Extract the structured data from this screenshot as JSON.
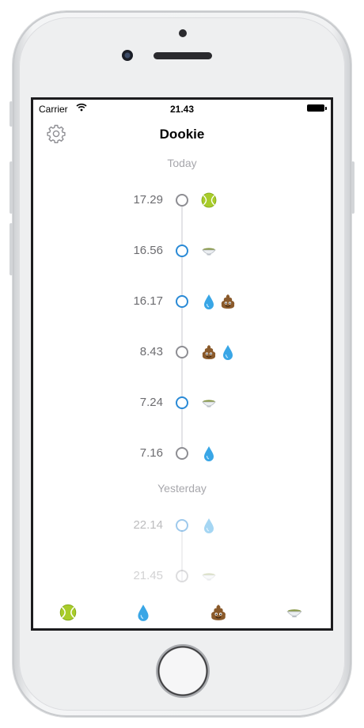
{
  "status_bar": {
    "carrier": "Carrier",
    "time": "21.43"
  },
  "nav": {
    "title": "Dookie",
    "settings_icon": "gear-icon"
  },
  "sections": [
    {
      "label": "Today",
      "entries": [
        {
          "time": "17.29",
          "dot": "gray",
          "icons": [
            "tennis-ball"
          ]
        },
        {
          "time": "16.56",
          "dot": "blue",
          "icons": [
            "food-bowl"
          ]
        },
        {
          "time": "16.17",
          "dot": "blue",
          "icons": [
            "water-drop",
            "poop"
          ]
        },
        {
          "time": "8.43",
          "dot": "gray",
          "icons": [
            "poop",
            "water-drop"
          ]
        },
        {
          "time": "7.24",
          "dot": "blue",
          "icons": [
            "food-bowl"
          ]
        },
        {
          "time": "7.16",
          "dot": "gray",
          "icons": [
            "water-drop"
          ]
        }
      ]
    },
    {
      "label": "Yesterday",
      "entries": [
        {
          "time": "22.14",
          "dot": "blue",
          "icons": [
            "water-drop"
          ]
        },
        {
          "time": "21.45",
          "dot": "gray",
          "icons": [
            "food-bowl"
          ]
        }
      ]
    }
  ],
  "tab_bar": [
    "tennis-ball",
    "water-drop",
    "poop",
    "food-bowl"
  ],
  "colors": {
    "accent_blue": "#2a8ad6",
    "neutral_dot": "#8e8e93",
    "section_gray": "#a7a7ac"
  }
}
